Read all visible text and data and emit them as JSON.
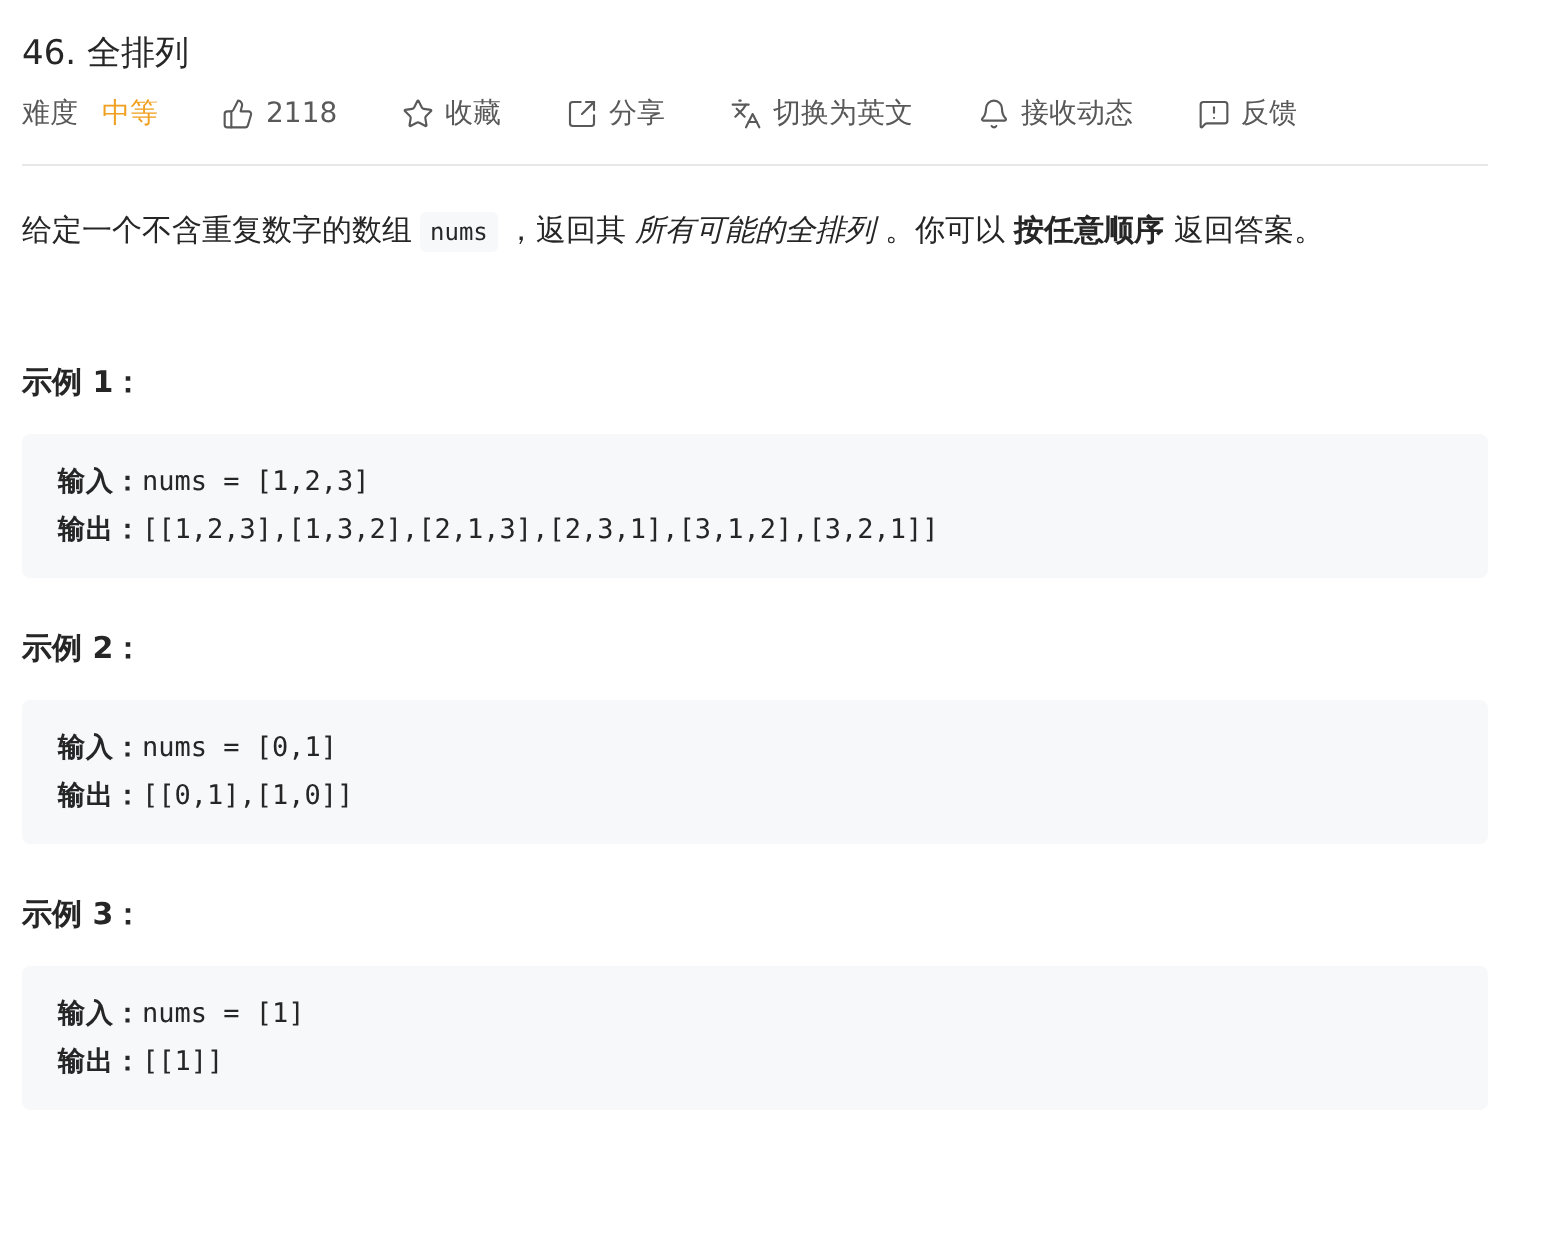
{
  "title": "46. 全排列",
  "toolbar": {
    "difficulty_label": "难度",
    "difficulty": "中等",
    "actions": [
      {
        "kind": "like",
        "label": "2118"
      },
      {
        "kind": "favorite",
        "label": "收藏"
      },
      {
        "kind": "share",
        "label": "分享"
      },
      {
        "kind": "translate",
        "label": "切换为英文"
      },
      {
        "kind": "notify",
        "label": "接收动态"
      },
      {
        "kind": "feedback",
        "label": "反馈"
      }
    ]
  },
  "description": {
    "before": "给定一个不含重复数字的数组",
    "code": "nums",
    "after": "，返回其 *所有可能的全排列* 。你可以 **按任意顺序** 返回答案。"
  },
  "examples": [
    {
      "heading": "示例 1：",
      "lines": [
        "**输入：**nums = [1,2,3]",
        "**输出：**[[1,2,3],[1,3,2],[2,1,3],[2,3,1],[3,1,2],[3,2,1]]"
      ]
    },
    {
      "heading": "示例 2：",
      "lines": [
        "**输入：**nums = [0,1]",
        "**输出：**[[0,1],[1,0]]"
      ]
    },
    {
      "heading": "示例 3：",
      "lines": [
        "**输入：**nums = [1]",
        "**输出：**[[1]]"
      ]
    }
  ]
}
